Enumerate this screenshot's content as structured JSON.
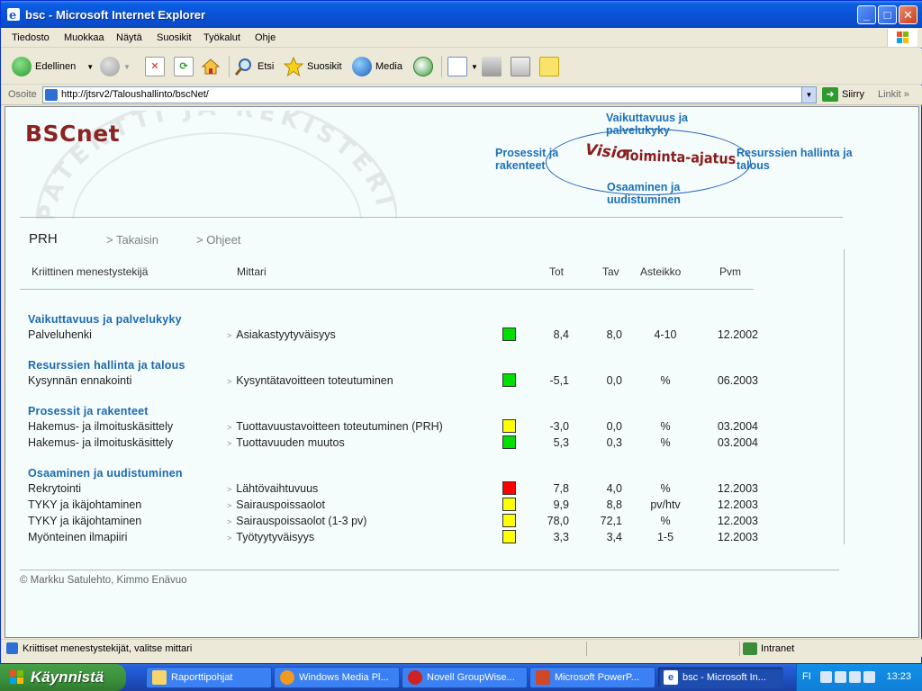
{
  "window": {
    "title": "bsc - Microsoft Internet Explorer"
  },
  "menu": [
    "Tiedosto",
    "Muokkaa",
    "Näytä",
    "Suosikit",
    "Työkalut",
    "Ohje"
  ],
  "toolbar": {
    "back": "Edellinen",
    "search": "Etsi",
    "favorites": "Suosikit",
    "media": "Media"
  },
  "address": {
    "label": "Osoite",
    "url": "http://jtsrv2/Taloushallinto/bscNet/",
    "go": "Siirry",
    "links": "Linkit"
  },
  "page": {
    "logo": "BSCnet",
    "nav": {
      "top": "Vaikuttavuus ja palvelukyky",
      "left": "Prosessit ja rakenteet",
      "right": "Resurssien hallinta ja talous",
      "bottom": "Osaaminen ja uudistuminen",
      "visio": "Visio",
      "toiminta": "Toiminta-ajatus"
    },
    "org": "PRH",
    "back_link": "> Takaisin",
    "help_link": "> Ohjeet",
    "headers": {
      "factor": "Kriittinen menestystekijä",
      "metric": "Mittari",
      "tot": "Tot",
      "tav": "Tav",
      "scale": "Asteikko",
      "date": "Pvm"
    },
    "sections": [
      {
        "title": "Vaikuttavuus ja palvelukyky",
        "rows": [
          {
            "factor": "Palveluhenki",
            "metric": "Asiakastyytyväisyys",
            "status": "#00e000",
            "tot": "8,4",
            "tav": "8,0",
            "scale": "4-10",
            "date": "12.2002"
          }
        ]
      },
      {
        "title": "Resurssien hallinta ja talous",
        "rows": [
          {
            "factor": "Kysynnän ennakointi",
            "metric": "Kysyntätavoitteen toteutuminen",
            "status": "#00e000",
            "tot": "-5,1",
            "tav": "0,0",
            "scale": "%",
            "date": "06.2003"
          }
        ]
      },
      {
        "title": "Prosessit ja rakenteet",
        "rows": [
          {
            "factor": "Hakemus- ja ilmoituskäsittely",
            "metric": "Tuottavuustavoitteen toteutuminen (PRH)",
            "status": "#ffff00",
            "tot": "-3,0",
            "tav": "0,0",
            "scale": "%",
            "date": "03.2004"
          },
          {
            "factor": "Hakemus- ja ilmoituskäsittely",
            "metric": "Tuottavuuden muutos",
            "status": "#00e000",
            "tot": "5,3",
            "tav": "0,3",
            "scale": "%",
            "date": "03.2004"
          }
        ]
      },
      {
        "title": "Osaaminen ja uudistuminen",
        "rows": [
          {
            "factor": "Rekrytointi",
            "metric": "Lähtövaihtuvuus",
            "status": "#ff0000",
            "tot": "7,8",
            "tav": "4,0",
            "scale": "%",
            "date": "12.2003"
          },
          {
            "factor": "TYKY ja ikäjohtaminen",
            "metric": "Sairauspoissaolot",
            "status": "#ffff00",
            "tot": "9,9",
            "tav": "8,8",
            "scale": "pv/htv",
            "date": "12.2003"
          },
          {
            "factor": "TYKY ja ikäjohtaminen",
            "metric": "Sairauspoissaolot (1-3 pv)",
            "status": "#ffff00",
            "tot": "78,0",
            "tav": "72,1",
            "scale": "%",
            "date": "12.2003"
          },
          {
            "factor": "Myönteinen ilmapiiri",
            "metric": "Työtyytyväisyys",
            "status": "#ffff00",
            "tot": "3,3",
            "tav": "3,4",
            "scale": "1-5",
            "date": "12.2003"
          }
        ]
      }
    ],
    "copyright": "© Markku Satulehto, Kimmo Enävuo"
  },
  "status": {
    "message": "Kriittiset menestystekijät, valitse mittari",
    "zone": "Intranet"
  },
  "taskbar": {
    "start": "Käynnistä",
    "tasks": [
      "Raporttipohjat",
      "Windows Media Pl...",
      "Novell GroupWise...",
      "Microsoft PowerP...",
      "bsc - Microsoft In..."
    ],
    "lang": "FI",
    "clock": "13:23"
  }
}
